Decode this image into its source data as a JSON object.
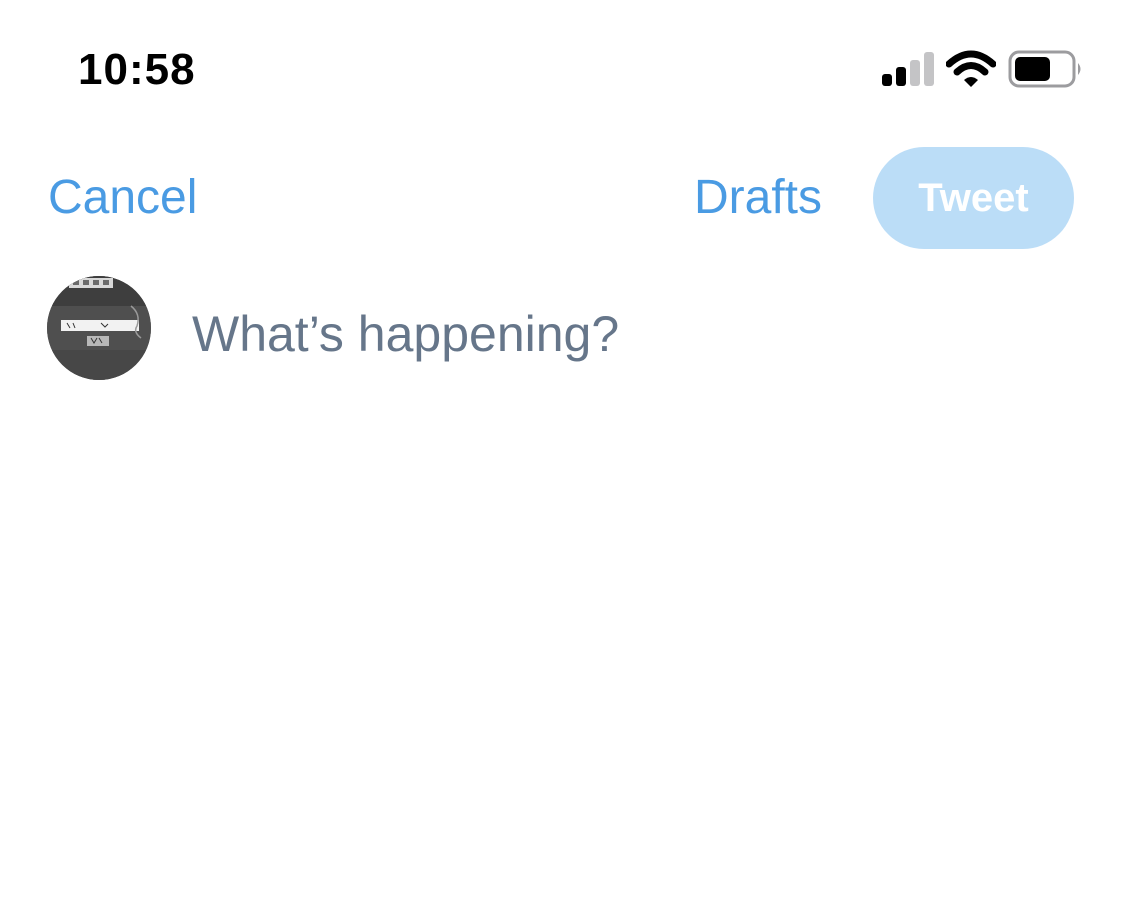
{
  "status_bar": {
    "time": "10:58",
    "icons": [
      "signal-icon",
      "wifi-icon",
      "battery-icon"
    ],
    "battery_level": 0.65
  },
  "header": {
    "cancel_label": "Cancel",
    "drafts_label": "Drafts",
    "tweet_label": "Tweet"
  },
  "composer": {
    "placeholder": "What’s happening?",
    "avatar": "user-avatar"
  },
  "colors": {
    "accent": "#4a9be3",
    "tweet_button_disabled_bg": "#bbddf7",
    "placeholder": "#66768a"
  }
}
